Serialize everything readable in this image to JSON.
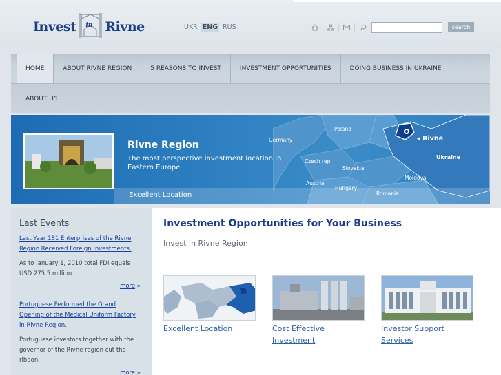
{
  "header": {
    "logo_left": "Invest",
    "logo_in": "in",
    "logo_right": "Rivne",
    "languages": [
      {
        "label": "UKR",
        "active": false
      },
      {
        "label": "ENG",
        "active": true
      },
      {
        "label": "RUS",
        "active": false
      }
    ],
    "tool_icons": [
      "home-icon",
      "sitemap-icon",
      "mail-icon",
      "search-icon"
    ],
    "search": {
      "value": "",
      "button": "search"
    }
  },
  "nav": {
    "row1": [
      "HOME",
      "ABOUT RIVNE REGION",
      "5 REASONS TO INVEST",
      "INVESTMENT OPPORTUNITIES",
      "DOING BUSINESS IN UKRAINE"
    ],
    "row2": [
      "ABOUT US"
    ],
    "active": "HOME"
  },
  "banner": {
    "title": "Rivne Region",
    "subtitle": "The most perspective investment location in Eastern Europe",
    "bottom": "Excellent Location",
    "map_labels": [
      "Poland",
      "Germany",
      "Czech rep.",
      "Slovakia",
      "Austria",
      "Hungary",
      "Romania",
      "Moldova",
      "Ukraine",
      "Rivne"
    ]
  },
  "sidebar": {
    "title": "Last Events",
    "events": [
      {
        "link": "Last Year 181 Enterprises of the Rivne Region Received Foreign Investments.",
        "text": "As to January 1, 2010 total FDI equals USD 275.5 million.",
        "more": "more"
      },
      {
        "link": "Portuguese Performed the Grand Opening of the Medical Uniform Factory in Rivne Region.",
        "text": "Portuguese investors together with the governor of the Rivne region cut the ribbon.",
        "more": "more"
      }
    ],
    "more_arrow": "»"
  },
  "main": {
    "title": "Investment Opportunities for Your Business",
    "subtitle": "Invest in Rivne Region",
    "cards": [
      {
        "label": "Excellent Location"
      },
      {
        "label": "Cost Effective Investment"
      },
      {
        "label": "Investor Support Services"
      }
    ]
  },
  "colors": {
    "brand_blue": "#1c3d8a",
    "link_blue": "#1840a0",
    "banner_blue": "#2c7ec0",
    "page_bg": "#dfe5ea"
  }
}
